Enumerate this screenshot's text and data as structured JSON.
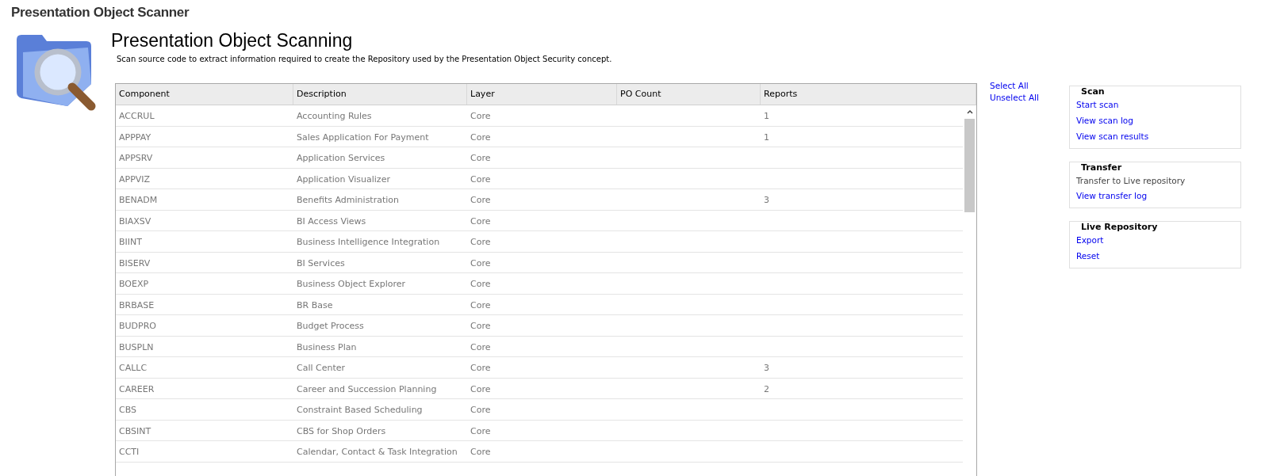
{
  "window": {
    "title": "Presentation Object Scanner"
  },
  "header": {
    "title": "Presentation Object Scanning",
    "description": "Scan source code to extract information required to create the Repository used by the Presentation Object Security concept."
  },
  "table": {
    "columns": [
      "Component",
      "Description",
      "Layer",
      "PO Count",
      "Reports"
    ],
    "rows": [
      [
        "ACCRUL",
        "Accounting Rules",
        "Core",
        "",
        "1"
      ],
      [
        "APPPAY",
        "Sales Application For Payment",
        "Core",
        "",
        "1"
      ],
      [
        "APPSRV",
        "Application Services",
        "Core",
        "",
        ""
      ],
      [
        "APPVIZ",
        "Application Visualizer",
        "Core",
        "",
        ""
      ],
      [
        "BENADM",
        "Benefits Administration",
        "Core",
        "",
        "3"
      ],
      [
        "BIAXSV",
        "BI Access Views",
        "Core",
        "",
        ""
      ],
      [
        "BIINT",
        "Business Intelligence Integration",
        "Core",
        "",
        ""
      ],
      [
        "BISERV",
        "BI Services",
        "Core",
        "",
        ""
      ],
      [
        "BOEXP",
        "Business Object Explorer",
        "Core",
        "",
        ""
      ],
      [
        "BRBASE",
        "BR Base",
        "Core",
        "",
        ""
      ],
      [
        "BUDPRO",
        "Budget Process",
        "Core",
        "",
        ""
      ],
      [
        "BUSPLN",
        "Business Plan",
        "Core",
        "",
        ""
      ],
      [
        "CALLC",
        "Call Center",
        "Core",
        "",
        "3"
      ],
      [
        "CAREER",
        "Career and Succession Planning",
        "Core",
        "",
        "2"
      ],
      [
        "CBS",
        "Constraint Based Scheduling",
        "Core",
        "",
        ""
      ],
      [
        "CBSINT",
        "CBS for Shop Orders",
        "Core",
        "",
        ""
      ],
      [
        "CCTI",
        "Calendar, Contact & Task Integration",
        "Core",
        "",
        ""
      ]
    ]
  },
  "selection_links": [
    "Select All",
    "Unselect All"
  ],
  "panels": [
    {
      "title": "Scan",
      "items": [
        {
          "label": "Start scan",
          "disabled": false
        },
        {
          "label": "View scan log",
          "disabled": false
        },
        {
          "label": "View scan results",
          "disabled": false
        }
      ]
    },
    {
      "title": "Transfer",
      "items": [
        {
          "label": "Transfer to Live repository",
          "disabled": true
        },
        {
          "label": "View transfer log",
          "disabled": false
        }
      ]
    },
    {
      "title": "Live Repository",
      "items": [
        {
          "label": "Export",
          "disabled": false
        },
        {
          "label": "Reset",
          "disabled": false
        }
      ]
    }
  ]
}
